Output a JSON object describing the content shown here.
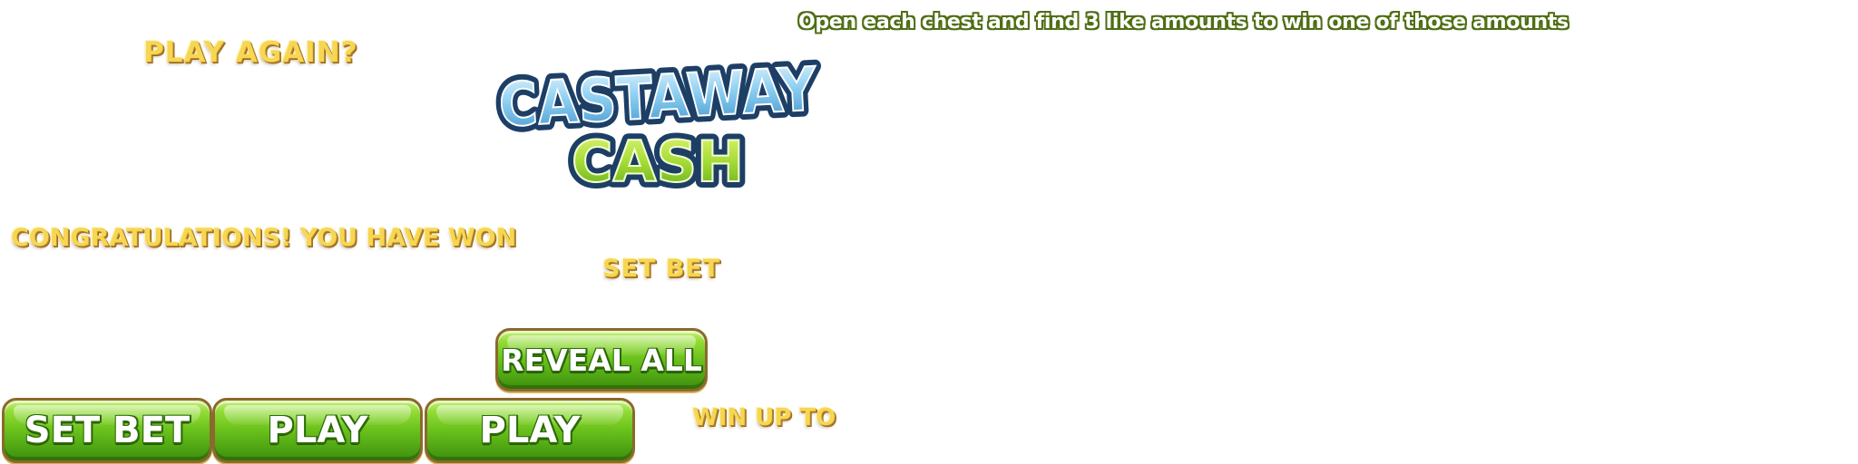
{
  "headings": {
    "play_again": "PLAY AGAIN?",
    "congratulations": "CONGRATULATIONS! YOU HAVE WON",
    "set_bet": "SET BET",
    "win_up_to": "WIN UP TO"
  },
  "instructions": "Open each chest and find 3 like amounts to win one of those amounts",
  "logo": {
    "line1": "CASTAWAY",
    "line2": "CASH"
  },
  "buttons": {
    "reveal_all": "REVEAL ALL",
    "set_bet": "SET BET",
    "play_1": "PLAY",
    "play_2": "PLAY"
  },
  "colors": {
    "gold_text": "#f6d652",
    "instruction_outline": "#4f6e14",
    "button_green": "#6fc51e",
    "button_border": "#8a6a2c",
    "logo_blue": "#7cc6ec",
    "logo_green": "#9ad93a",
    "logo_outline": "#1d3f66"
  }
}
